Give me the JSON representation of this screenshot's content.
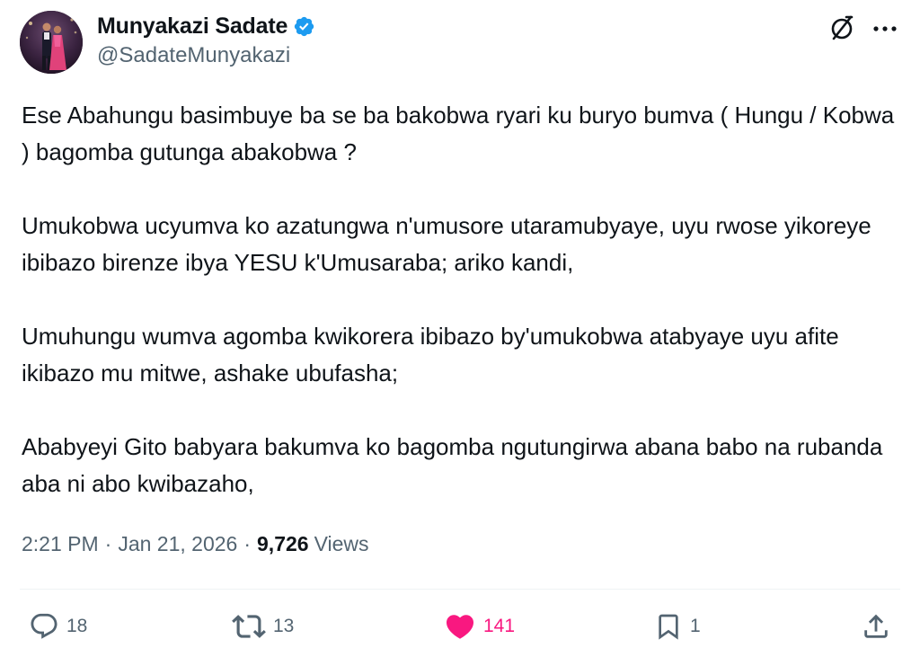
{
  "author": {
    "name": "Munyakazi Sadate",
    "handle": "@SadateMunyakazi",
    "verified": true,
    "verified_color": "#1d9bf0"
  },
  "header_icons": {
    "grok": "grok-icon",
    "more": "more-icon"
  },
  "tweet": {
    "paragraphs": [
      "Ese Abahungu basimbuye ba se ba bakobwa ryari ku buryo bumva ( Hungu / Kobwa ) bagomba gutunga abakobwa ?",
      "Umukobwa ucyumva ko azatungwa n'umusore utaramubyaye, uyu rwose yikoreye ibibazo birenze ibya YESU k'Umusaraba; ariko kandi,",
      "Umuhungu wumva agomba kwikorera ibibazo by'umukobwa atabyaye uyu afite ikibazo mu mitwe, ashake ubufasha;",
      "Ababyeyi Gito babyara bakumva ko bagomba ngutungirwa abana babo na rubanda aba ni abo kwibazaho,"
    ]
  },
  "meta": {
    "time": "2:21 PM",
    "separator": "·",
    "date": "Jan 21, 2026",
    "views_count": "9,726",
    "views_label": "Views"
  },
  "actions": {
    "replies": {
      "icon": "reply-icon",
      "count": "18"
    },
    "reposts": {
      "icon": "repost-icon",
      "count": "13"
    },
    "likes": {
      "icon": "heart-icon",
      "count": "141",
      "color": "#f91880"
    },
    "bookmarks": {
      "icon": "bookmark-icon",
      "count": "1"
    },
    "share": {
      "icon": "share-icon"
    }
  },
  "colors": {
    "text": "#0f1419",
    "secondary": "#536471",
    "like": "#f91880",
    "verified": "#1d9bf0"
  }
}
